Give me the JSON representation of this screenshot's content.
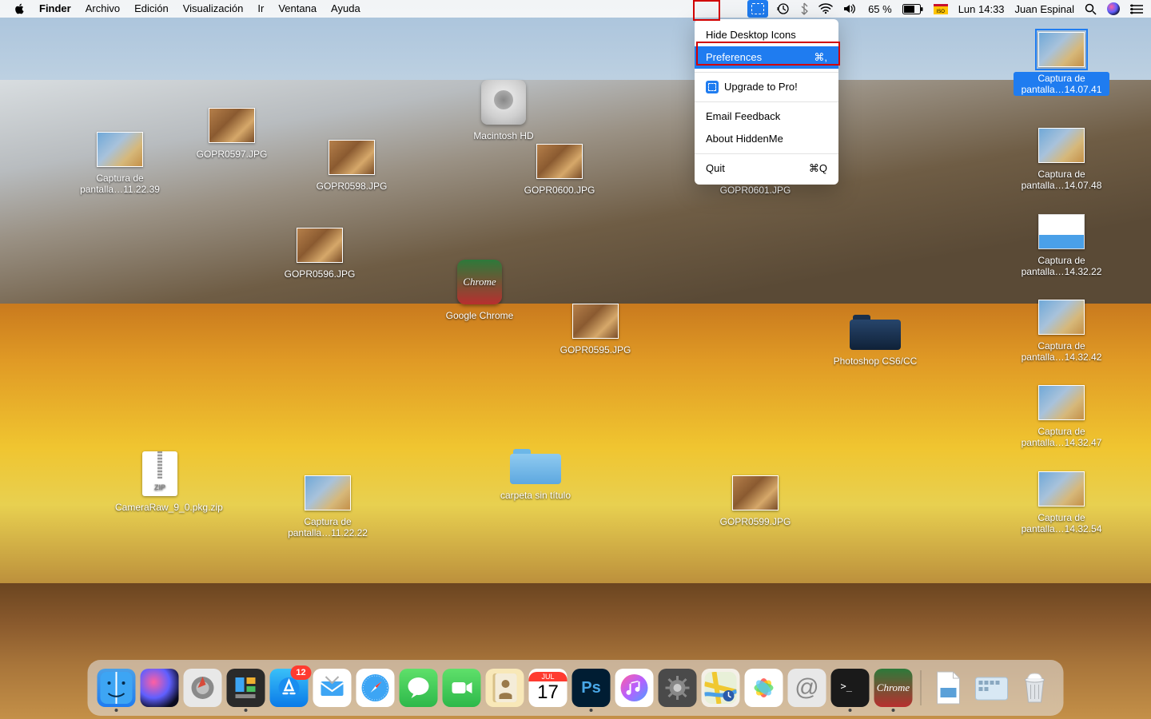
{
  "menubar": {
    "appmenu": [
      "Finder",
      "Archivo",
      "Edición",
      "Visualización",
      "Ir",
      "Ventana",
      "Ayuda"
    ],
    "battery": "65 %",
    "clock": "Lun 14:33",
    "user": "Juan Espinal"
  },
  "dropdown": {
    "hide": "Hide Desktop Icons",
    "prefs": "Preferences",
    "prefs_sc": "⌘,",
    "upgrade": "Upgrade to Pro!",
    "feedback": "Email Feedback",
    "about": "About HiddenMe",
    "quit": "Quit",
    "quit_sc": "⌘Q"
  },
  "icons": {
    "hd": "Macintosh HD",
    "cap1": "Captura de pantalla…11.22.39",
    "g597": "GOPR0597.JPG",
    "g598": "GOPR0598.JPG",
    "g600": "GOPR0600.JPG",
    "g601": "GOPR0601.JPG",
    "g596": "GOPR0596.JPG",
    "chrome": "Google Chrome",
    "chrome_tile": "Chrome",
    "g595": "GOPR0595.JPG",
    "ps": "Photoshop CS6/CC",
    "zip": "CameraRaw_9_0.pkg.zip",
    "cap2": "Captura de pantalla…11.22.22",
    "carpeta": "carpeta sin título",
    "g599": "GOPR0599.JPG",
    "sel": "Captura de pantalla…14.07.41",
    "r2": "Captura de pantalla…14.07.48",
    "r3": "Captura de pantalla…14.32.22",
    "r4": "Captura de pantalla…14.32.42",
    "r5": "Captura de pantalla…14.32.47",
    "r6": "Captura de pantalla…14.32.54"
  },
  "dock": {
    "badge_appstore": "12",
    "cal_month": "JUL",
    "cal_day": "17"
  }
}
